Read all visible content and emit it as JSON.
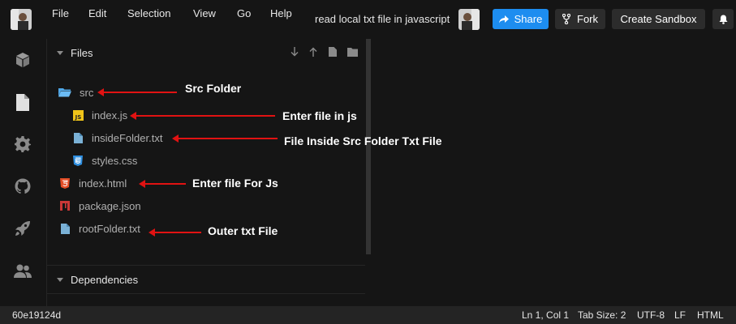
{
  "menu": {
    "items": [
      "File",
      "Edit",
      "Selection",
      "View",
      "Go",
      "Help"
    ]
  },
  "sandbox_title": "read local txt file in javascript",
  "buttons": {
    "share": "Share",
    "fork": "Fork",
    "create": "Create Sandbox"
  },
  "files_panel": {
    "header": "Files",
    "tree": [
      {
        "name": "src",
        "icon": "folder-icon"
      },
      {
        "name": "index.js",
        "icon": "js-file-icon"
      },
      {
        "name": "insideFolder.txt",
        "icon": "txt-file-icon"
      },
      {
        "name": "styles.css",
        "icon": "css-file-icon"
      },
      {
        "name": "index.html",
        "icon": "html-file-icon"
      },
      {
        "name": "package.json",
        "icon": "npm-file-icon"
      },
      {
        "name": "rootFolder.txt",
        "icon": "txt-file-icon"
      }
    ]
  },
  "dependencies_panel": {
    "header": "Dependencies"
  },
  "annotations": {
    "src_folder": "Src Folder",
    "enter_file_js": "Enter file in js",
    "inside_txt": "File Inside Src Folder Txt File",
    "enter_file_for_js": "Enter file For Js",
    "outer_txt": "Outer txt File"
  },
  "status": {
    "commit": "60e19124d",
    "position": "Ln 1, Col 1",
    "tab_size": "Tab Size: 2",
    "encoding": "UTF-8",
    "eol": "LF",
    "language": "HTML"
  },
  "colors": {
    "accent": "#1d8df0",
    "annotation_arrow": "#e11212",
    "background": "#151515"
  }
}
